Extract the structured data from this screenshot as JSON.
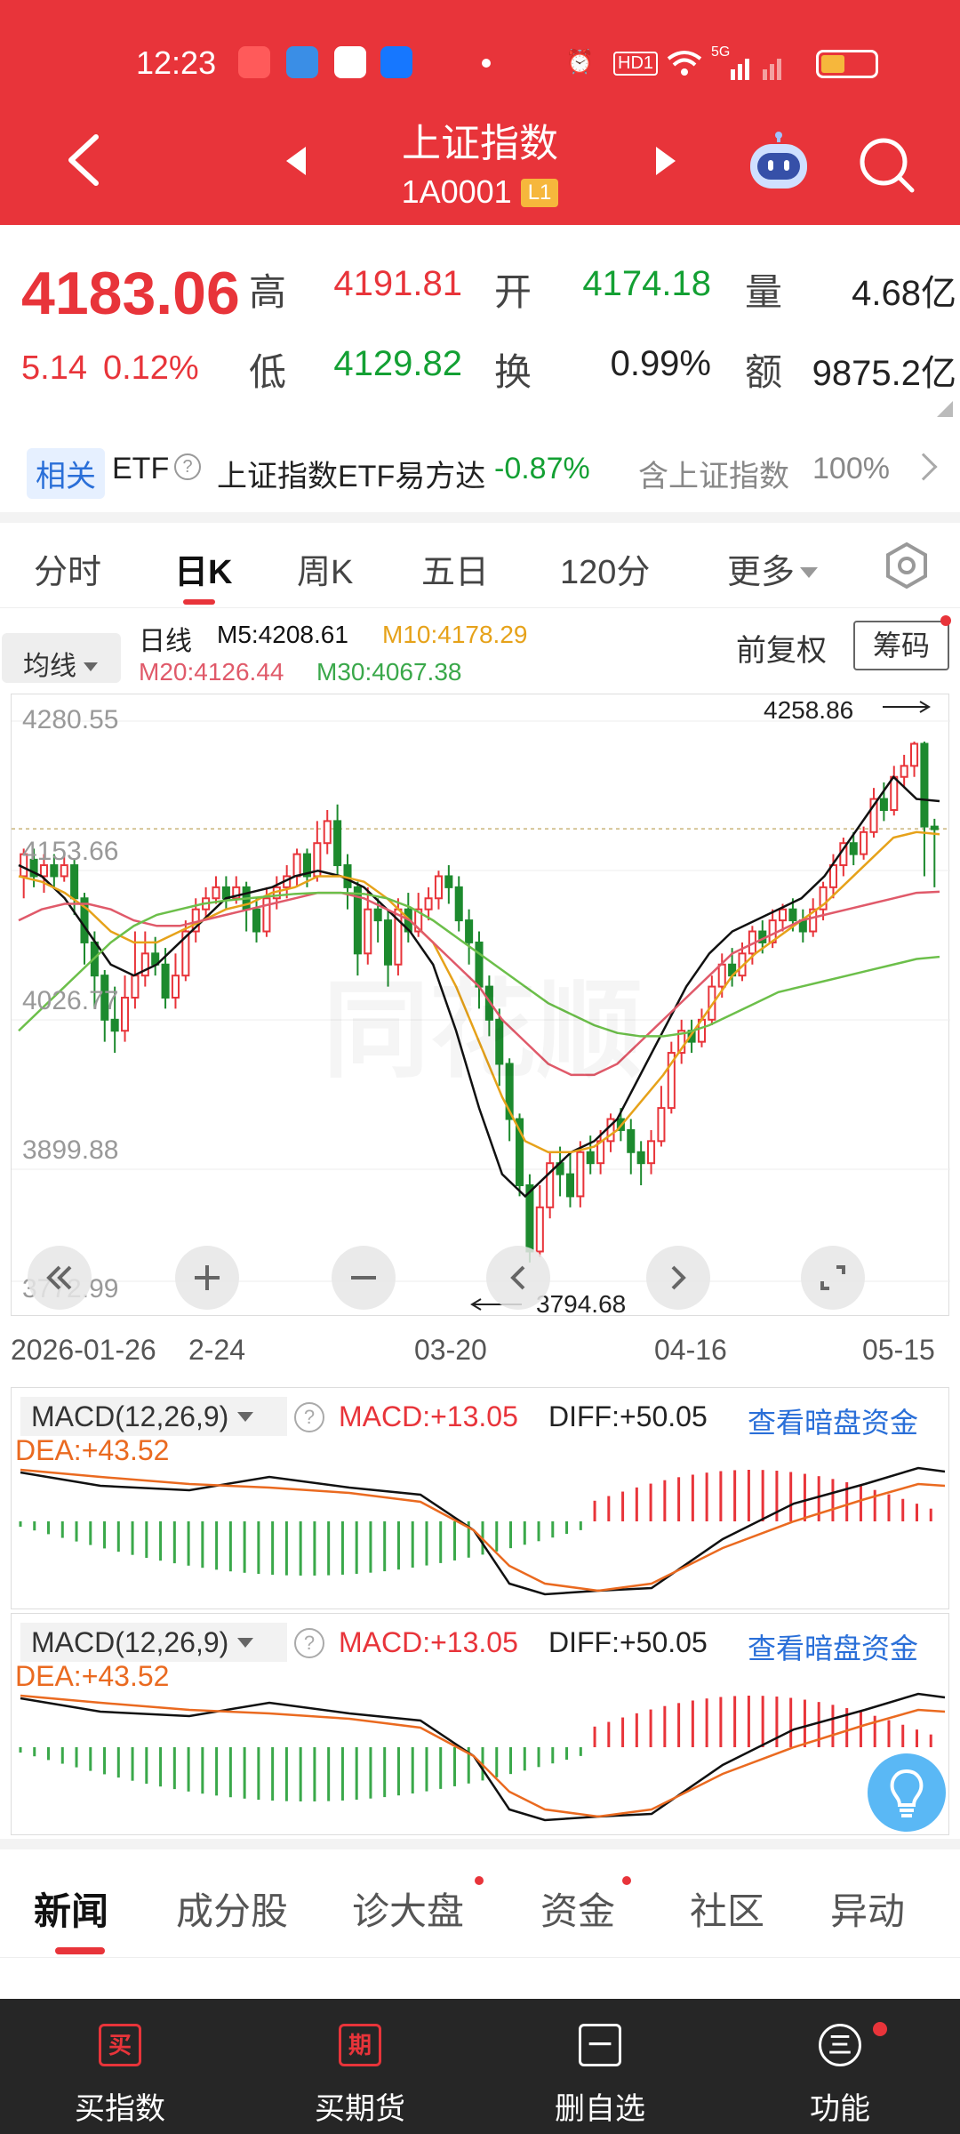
{
  "status_bar": {
    "time": "12:23",
    "hd": "HD1",
    "signal": "5G"
  },
  "header": {
    "title": "上证指数",
    "code": "1A0001",
    "level": "L1"
  },
  "quote": {
    "price": "4183.06",
    "change": "5.14",
    "change_pct": "0.12%",
    "high_label": "高",
    "high": "4191.81",
    "open_label": "开",
    "open": "4174.18",
    "vol_label": "量",
    "vol": "4.68亿",
    "low_label": "低",
    "low": "4129.82",
    "turn_label": "换",
    "turn": "0.99%",
    "amt_label": "额",
    "amt": "9875.2亿"
  },
  "etf": {
    "tag": "相关",
    "label": "ETF",
    "name": "上证指数ETF易方达",
    "change": "-0.87%",
    "contains_label": "含上证指数",
    "contains_pct": "100%"
  },
  "period_tabs": [
    "分时",
    "日K",
    "周K",
    "五日",
    "120分",
    "更多"
  ],
  "ma_row": {
    "selector": "均线",
    "type": "日线",
    "m5": "M5:4208.61",
    "m10": "M10:4178.29",
    "m20": "M20:4126.44",
    "m30": "M30:4067.38",
    "fuquan": "前复权",
    "chouma": "筹码"
  },
  "kline": {
    "y_labels": [
      "4280.55",
      "4153.66",
      "4026.77",
      "3899.88",
      "3772.99"
    ],
    "high_mark": "4258.86",
    "low_mark": "3794.68",
    "x_labels": [
      "2026-01-26",
      "2-24",
      "03-20",
      "04-16",
      "05-15"
    ],
    "watermark": "同花顺"
  },
  "macd": {
    "selector": "MACD(12,26,9)",
    "macd": "MACD:+13.05",
    "diff": "DIFF:+50.05",
    "dea": "DEA:+43.52",
    "link": "查看暗盘资金"
  },
  "news_tabs": [
    "新闻",
    "成分股",
    "诊大盘",
    "资金",
    "社区",
    "异动"
  ],
  "bottom_nav": [
    {
      "icon": "买",
      "label": "买指数"
    },
    {
      "icon": "期",
      "label": "买期货"
    },
    {
      "icon": "一",
      "label": "删自选"
    },
    {
      "icon": "三",
      "label": "功能"
    }
  ],
  "chart_data": {
    "type": "candlestick",
    "y_range": [
      3772.99,
      4280.55
    ],
    "annotations": {
      "high": 4258.86,
      "low": 3794.68
    },
    "candles": [
      [
        4140,
        4160,
        4120,
        4165
      ],
      [
        4155,
        4140,
        4130,
        4165
      ],
      [
        4140,
        4150,
        4125,
        4160
      ],
      [
        4150,
        4140,
        4130,
        4160
      ],
      [
        4140,
        4150,
        4135,
        4160
      ],
      [
        4150,
        4120,
        4105,
        4155
      ],
      [
        4120,
        4080,
        4060,
        4125
      ],
      [
        4080,
        4050,
        4020,
        4090
      ],
      [
        4050,
        4010,
        3990,
        4055
      ],
      [
        4010,
        4000,
        3980,
        4040
      ],
      [
        4000,
        4030,
        3990,
        4050
      ],
      [
        4030,
        4050,
        4020,
        4090
      ],
      [
        4050,
        4070,
        4040,
        4090
      ],
      [
        4070,
        4060,
        4050,
        4085
      ],
      [
        4060,
        4030,
        4020,
        4075
      ],
      [
        4030,
        4050,
        4020,
        4070
      ],
      [
        4050,
        4090,
        4045,
        4100
      ],
      [
        4090,
        4110,
        4080,
        4120
      ],
      [
        4110,
        4120,
        4100,
        4130
      ],
      [
        4120,
        4130,
        4115,
        4140
      ],
      [
        4130,
        4120,
        4110,
        4140
      ],
      [
        4120,
        4130,
        4115,
        4140
      ],
      [
        4130,
        4110,
        4090,
        4135
      ],
      [
        4110,
        4090,
        4080,
        4120
      ],
      [
        4090,
        4120,
        4085,
        4130
      ],
      [
        4120,
        4130,
        4110,
        4140
      ],
      [
        4130,
        4140,
        4120,
        4150
      ],
      [
        4140,
        4160,
        4130,
        4165
      ],
      [
        4160,
        4140,
        4130,
        4165
      ],
      [
        4140,
        4170,
        4135,
        4190
      ],
      [
        4170,
        4190,
        4160,
        4200
      ],
      [
        4190,
        4150,
        4140,
        4205
      ],
      [
        4150,
        4130,
        4110,
        4160
      ],
      [
        4130,
        4070,
        4050,
        4135
      ],
      [
        4070,
        4110,
        4060,
        4130
      ],
      [
        4110,
        4100,
        4080,
        4120
      ],
      [
        4100,
        4060,
        4040,
        4110
      ],
      [
        4060,
        4110,
        4050,
        4120
      ],
      [
        4110,
        4090,
        4080,
        4125
      ],
      [
        4090,
        4110,
        4085,
        4125
      ],
      [
        4110,
        4120,
        4100,
        4130
      ],
      [
        4120,
        4140,
        4110,
        4145
      ],
      [
        4140,
        4130,
        4115,
        4150
      ],
      [
        4130,
        4100,
        4090,
        4140
      ],
      [
        4100,
        4080,
        4060,
        4110
      ],
      [
        4080,
        4040,
        4020,
        4090
      ],
      [
        4040,
        4010,
        3995,
        4050
      ],
      [
        4010,
        3970,
        3950,
        4020
      ],
      [
        3970,
        3920,
        3900,
        3975
      ],
      [
        3920,
        3860,
        3850,
        3925
      ],
      [
        3860,
        3800,
        3790,
        3870
      ],
      [
        3800,
        3840,
        3795,
        3860
      ],
      [
        3840,
        3880,
        3830,
        3890
      ],
      [
        3880,
        3870,
        3850,
        3895
      ],
      [
        3870,
        3850,
        3840,
        3890
      ],
      [
        3850,
        3890,
        3840,
        3900
      ],
      [
        3890,
        3880,
        3870,
        3905
      ],
      [
        3880,
        3900,
        3870,
        3910
      ],
      [
        3900,
        3920,
        3890,
        3925
      ],
      [
        3920,
        3910,
        3900,
        3930
      ],
      [
        3910,
        3890,
        3870,
        3920
      ],
      [
        3890,
        3880,
        3860,
        3900
      ],
      [
        3880,
        3900,
        3870,
        3910
      ],
      [
        3900,
        3930,
        3895,
        3950
      ],
      [
        3930,
        3980,
        3925,
        3990
      ],
      [
        3980,
        4000,
        3970,
        4010
      ],
      [
        4000,
        3990,
        3980,
        4010
      ],
      [
        3990,
        4010,
        3985,
        4020
      ],
      [
        4010,
        4040,
        4005,
        4050
      ],
      [
        4040,
        4060,
        4030,
        4070
      ],
      [
        4060,
        4050,
        4040,
        4075
      ],
      [
        4050,
        4070,
        4045,
        4080
      ],
      [
        4070,
        4090,
        4060,
        4095
      ],
      [
        4090,
        4080,
        4070,
        4100
      ],
      [
        4080,
        4100,
        4075,
        4110
      ],
      [
        4100,
        4110,
        4090,
        4115
      ],
      [
        4110,
        4100,
        4090,
        4120
      ],
      [
        4100,
        4090,
        4080,
        4110
      ],
      [
        4090,
        4110,
        4085,
        4120
      ],
      [
        4110,
        4130,
        4100,
        4135
      ],
      [
        4130,
        4150,
        4120,
        4160
      ],
      [
        4150,
        4170,
        4140,
        4175
      ],
      [
        4170,
        4160,
        4150,
        4180
      ],
      [
        4160,
        4180,
        4155,
        4185
      ],
      [
        4180,
        4210,
        4175,
        4220
      ],
      [
        4210,
        4200,
        4190,
        4225
      ],
      [
        4200,
        4230,
        4195,
        4240
      ],
      [
        4230,
        4240,
        4220,
        4250
      ],
      [
        4240,
        4260,
        4230,
        4262
      ],
      [
        4260,
        4185,
        4140,
        4262
      ],
      [
        4185,
        4183,
        4130,
        4192
      ]
    ],
    "series": [
      {
        "values": [
          4150,
          4140,
          4120,
          4090,
          4060,
          4050,
          4060,
          4080,
          4100,
          4120,
          4125,
          4130,
          4140,
          4145,
          4140,
          4130,
          4110,
          4090,
          4060,
          4000,
          3930,
          3870,
          3850,
          3870,
          3890,
          3900,
          3920,
          3960,
          4000,
          4040,
          4070,
          4090,
          4100,
          4110,
          4120,
          4140,
          4170,
          4200,
          4230,
          4210,
          4208
        ]
      },
      {
        "values": [
          4140,
          4135,
          4125,
          4110,
          4090,
          4080,
          4080,
          4090,
          4100,
          4110,
          4115,
          4125,
          4130,
          4140,
          4140,
          4135,
          4120,
          4100,
          4080,
          4040,
          3990,
          3940,
          3900,
          3890,
          3890,
          3895,
          3910,
          3935,
          3960,
          3990,
          4020,
          4050,
          4070,
          4085,
          4100,
          4115,
          4135,
          4155,
          4175,
          4180,
          4178
        ]
      },
      {
        "values": [
          4100,
          4110,
          4115,
          4115,
          4110,
          4100,
          4095,
          4095,
          4100,
          4105,
          4110,
          4115,
          4120,
          4125,
          4125,
          4120,
          4110,
          4100,
          4080,
          4060,
          4040,
          4010,
          3990,
          3970,
          3960,
          3960,
          3970,
          3990,
          4010,
          4030,
          4050,
          4070,
          4080,
          4090,
          4100,
          4105,
          4110,
          4115,
          4120,
          4125,
          4126
        ]
      },
      {
        "values": [
          4000,
          4020,
          4040,
          4060,
          4080,
          4095,
          4105,
          4110,
          4115,
          4118,
          4120,
          4122,
          4124,
          4125,
          4125,
          4124,
          4120,
          4112,
          4100,
          4085,
          4070,
          4055,
          4040,
          4025,
          4015,
          4005,
          3998,
          3995,
          3995,
          3998,
          4005,
          4015,
          4025,
          4035,
          4040,
          4045,
          4050,
          4055,
          4060,
          4065,
          4067
        ]
      }
    ],
    "colors": {
      "ma5": "#111111",
      "ma10": "#e6a21a",
      "ma20": "#e05a6a",
      "ma30": "#6cbf4a",
      "up": "#e8343a",
      "down": "#1d8a2e"
    }
  }
}
